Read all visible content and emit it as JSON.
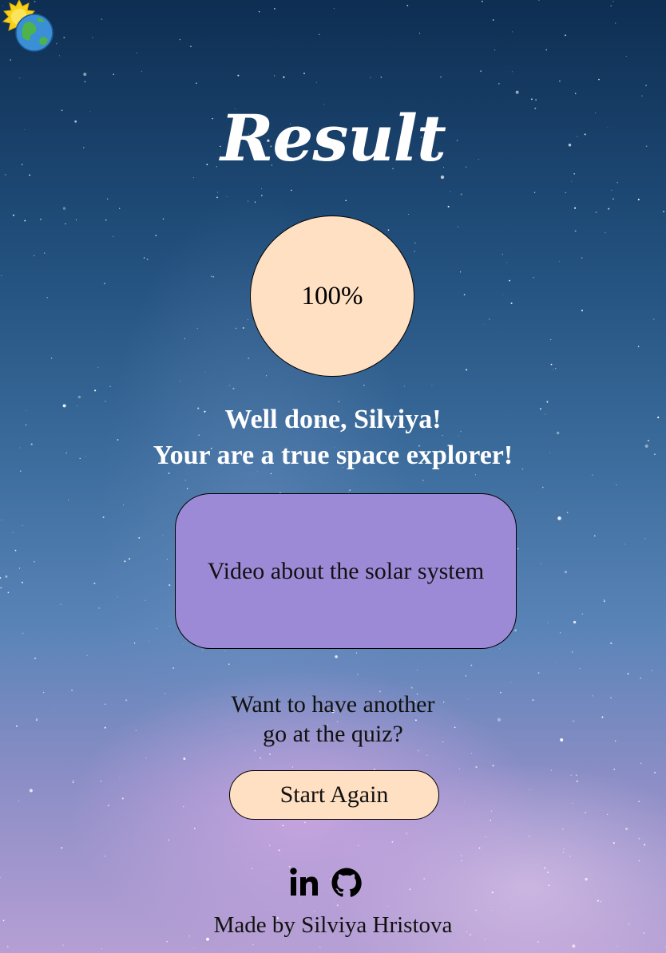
{
  "header": {
    "logo_icon": "sun-earth-icon"
  },
  "result": {
    "title": "Result",
    "score": "100%",
    "message_line1": "Well done, Silviya!",
    "message_line2": "Your are a true space explorer!"
  },
  "video": {
    "label": "Video about the solar system"
  },
  "again": {
    "prompt_line1": "Want to have another",
    "prompt_line2": "go at the quiz?",
    "button_label": "Start Again"
  },
  "footer": {
    "linkedin_icon": "linkedin-icon",
    "github_icon": "github-icon",
    "credit": "Made by Silviya Hristova"
  },
  "colors": {
    "score_circle": "#ffe0c2",
    "video_button": "#9d8ad6",
    "start_button": "#ffe0c2",
    "heading_text": "#ffffff"
  }
}
